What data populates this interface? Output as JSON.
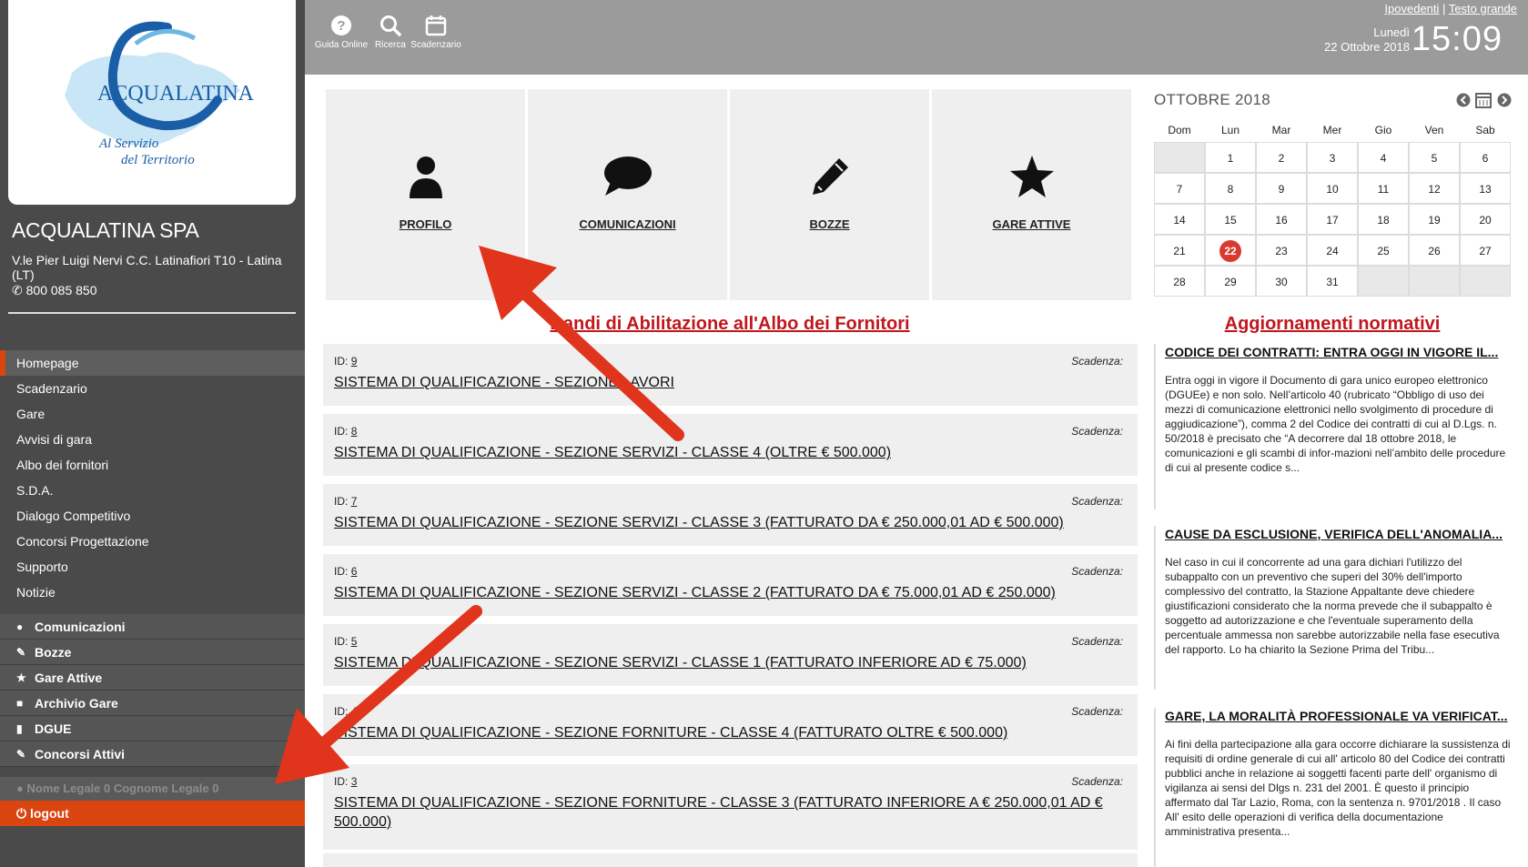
{
  "sidebar": {
    "logo": {
      "brand": "ACQUALATINA",
      "tagline_1": "Al Servizio",
      "tagline_2": "del Territorio",
      "brand_color": "#1b5ea8"
    },
    "org_name": "ACQUALATINA SPA",
    "address": "V.le Pier Luigi Nervi C.C. Latinafiori T10 - Latina (LT)",
    "phone": "800 085 850",
    "nav": [
      {
        "label": "Homepage"
      },
      {
        "label": "Scadenzario"
      },
      {
        "label": "Gare"
      },
      {
        "label": "Avvisi di gara"
      },
      {
        "label": "Albo dei fornitori"
      },
      {
        "label": "S.D.A."
      },
      {
        "label": "Dialogo Competitivo"
      },
      {
        "label": "Concorsi Progettazione"
      },
      {
        "label": "Supporto"
      },
      {
        "label": "Notizie"
      }
    ],
    "quick": [
      {
        "label": "Comunicazioni",
        "icon": "speech-bubble-icon"
      },
      {
        "label": "Bozze",
        "icon": "pencil-icon"
      },
      {
        "label": "Gare Attive",
        "icon": "star-icon"
      },
      {
        "label": "Archivio Gare",
        "icon": "folder-icon"
      },
      {
        "label": "DGUE",
        "icon": "document-icon"
      },
      {
        "label": "Concorsi Attivi",
        "icon": "pencil-icon"
      }
    ],
    "user": "Nome Legale 0 Cognome Legale 0",
    "logout": "logout",
    "accent_color": "#d9440f"
  },
  "topbar": {
    "buttons": [
      {
        "label": "Guida Online",
        "icon": "question-icon"
      },
      {
        "label": "Ricerca",
        "icon": "search-icon"
      },
      {
        "label": "Scadenzario",
        "icon": "calendar-icon"
      }
    ],
    "access_links": [
      "Ipovedenti",
      "Testo grande"
    ],
    "day": "Lunedì",
    "date": "22 Ottobre 2018",
    "time": "15:09"
  },
  "tiles": [
    {
      "label": "PROFILO",
      "icon": "user-icon"
    },
    {
      "label": "COMUNICAZIONI",
      "icon": "speech-bubble-icon"
    },
    {
      "label": "BOZZE",
      "icon": "pencil-icon"
    },
    {
      "label": "GARE ATTIVE",
      "icon": "star-icon"
    }
  ],
  "bandi": {
    "title": "Bandi di Abilitazione all'Albo dei Fornitori",
    "id_label": "ID:",
    "scadenza_label": "Scadenza:",
    "items": [
      {
        "id": "9",
        "title": "SISTEMA DI QUALIFICAZIONE - SEZIONE LAVORI"
      },
      {
        "id": "8",
        "title": "SISTEMA DI QUALIFICAZIONE - SEZIONE SERVIZI - CLASSE 4 (OLTRE € 500.000)"
      },
      {
        "id": "7",
        "title": "SISTEMA DI QUALIFICAZIONE - SEZIONE SERVIZI - CLASSE 3 (FATTURATO DA € 250.000,01 AD € 500.000)"
      },
      {
        "id": "6",
        "title": "SISTEMA DI QUALIFICAZIONE - SEZIONE SERVIZI - CLASSE 2 (FATTURATO DA € 75.000,01 AD € 250.000)"
      },
      {
        "id": "5",
        "title": "SISTEMA DI QUALIFICAZIONE - SEZIONE SERVIZI - CLASSE 1 (FATTURATO INFERIORE AD € 75.000)"
      },
      {
        "id": "4",
        "title": "SISTEMA DI QUALIFICAZIONE - SEZIONE FORNITURE - CLASSE 4 (FATTURATO OLTRE € 500.000)"
      },
      {
        "id": "3",
        "title": "SISTEMA DI QUALIFICAZIONE - SEZIONE FORNITURE - CLASSE 3 (FATTURATO INFERIORE A € 250.000,01 AD € 500.000)"
      }
    ]
  },
  "calendar": {
    "title": "OTTOBRE 2018",
    "weekdays": [
      "Dom",
      "Lun",
      "Mar",
      "Mer",
      "Gio",
      "Ven",
      "Sab"
    ],
    "weeks": [
      [
        "",
        "1",
        "2",
        "3",
        "4",
        "5",
        "6"
      ],
      [
        "7",
        "8",
        "9",
        "10",
        "11",
        "12",
        "13"
      ],
      [
        "14",
        "15",
        "16",
        "17",
        "18",
        "19",
        "20"
      ],
      [
        "21",
        "22",
        "23",
        "24",
        "25",
        "26",
        "27"
      ],
      [
        "28",
        "29",
        "30",
        "31",
        "",
        "",
        ""
      ]
    ],
    "today": "22",
    "today_color": "#d93a30"
  },
  "news": {
    "title": "Aggiornamenti normativi",
    "items": [
      {
        "title": "CODICE DEI CONTRATTI: ENTRA OGGI IN VIGORE IL...",
        "body": "Entra oggi in vigore il Documento di gara unico europeo elettronico (DGUEe) e non solo. Nell’articolo 40 (rubricato “Obbligo di uso dei mezzi di comunicazione elettronici nello svolgimento di procedure di aggiudicazione”), comma 2 del Codice dei contratti di cui al D.Lgs. n. 50/2018 è precisato che “A decorrere dal 18 ottobre 2018, le comunicazioni e gli scambi di infor-mazioni nell’ambito delle procedure di cui al presente codice s..."
      },
      {
        "title": "CAUSE DA ESCLUSIONE, VERIFICA DELL'ANOMALIA...",
        "body": "Nel caso in cui il concorrente ad una gara dichiari l'utilizzo del subappalto con un preventivo che superi del 30% dell'importo complessivo del contratto, la Stazione Appaltante deve chiedere giustificazioni considerato che la norma prevede che il subappalto è soggetto ad autorizzazione e che l'eventuale superamento della percentuale ammessa non sarebbe autorizzabile nella fase esecutiva del rapporto. Lo ha chiarito la Sezione Prima del Tribu..."
      },
      {
        "title": "GARE, LA MORALITÀ PROFESSIONALE VA VERIFICAT...",
        "body": "Ai fini della partecipazione alla gara occorre dichiarare la sussistenza di requisiti di ordine generale di cui all' articolo 80 del Codice dei contratti pubblici anche in relazione ai soggetti facenti parte dell' organismo di vigilanza ai sensi del Dlgs n. 231 del 2001. È questo il principio affermato dal Tar Lazio, Roma, con la sentenza n. 9701/2018 . Il caso All' esito delle operazioni di verifica della documentazione amministrativa presenta..."
      }
    ]
  },
  "annotation_color": "#e0341c"
}
